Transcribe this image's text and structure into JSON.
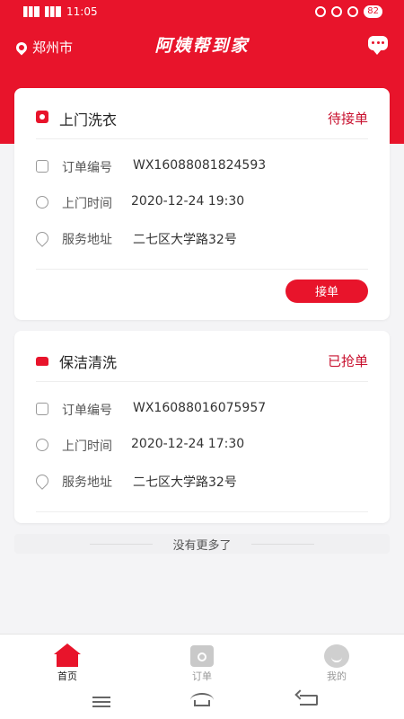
{
  "status_bar": {
    "time": "11:05",
    "battery": "82"
  },
  "header": {
    "location": "郑州市",
    "brand": "阿姨帮到家"
  },
  "orders": [
    {
      "service": "上门洗衣",
      "status": "待接单",
      "order_no_label": "订单编号",
      "order_no": "WX16088081824593",
      "visit_time_label": "上门时间",
      "visit_time": "2020-12-24 19:30",
      "address_label": "服务地址",
      "address": "二七区大学路32号",
      "action_label": "接单"
    },
    {
      "service": "保洁清洗",
      "status": "已抢单",
      "order_no_label": "订单编号",
      "order_no": "WX16088016075957",
      "visit_time_label": "上门时间",
      "visit_time": "2020-12-24 17:30",
      "address_label": "服务地址",
      "address": "二七区大学路32号"
    }
  ],
  "list_footer": "没有更多了",
  "tabs": [
    {
      "label": "首页",
      "icon": "home-icon",
      "active": true
    },
    {
      "label": "订单",
      "icon": "order-icon",
      "active": false
    },
    {
      "label": "我的",
      "icon": "profile-icon",
      "active": false
    }
  ],
  "colors": {
    "brand": "#e8142b",
    "status_text": "#c8102e"
  }
}
